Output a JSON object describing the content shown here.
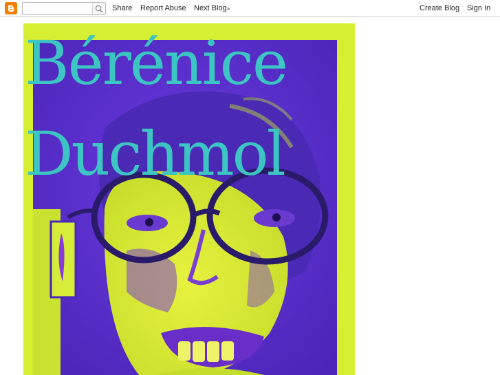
{
  "navbar": {
    "search_value": "",
    "links": {
      "share": "Share",
      "report_abuse": "Report Abuse",
      "next_blog": "Next Blog",
      "next_blog_arrow": "»",
      "create_blog": "Create Blog",
      "sign_in": "Sign In"
    },
    "icons": {
      "logo": "blogger-logo-icon",
      "search": "search-icon"
    },
    "colors": {
      "logo": "#f57d00",
      "border": "#c8c8c8"
    }
  },
  "header": {
    "title_line1": "Bérénice",
    "title_line2": "Duchmol",
    "colors": {
      "title": "#3cc5c2",
      "frame": "#d7ef32",
      "portrait_background": "#5a2fd6",
      "face": "#dde83a"
    }
  }
}
